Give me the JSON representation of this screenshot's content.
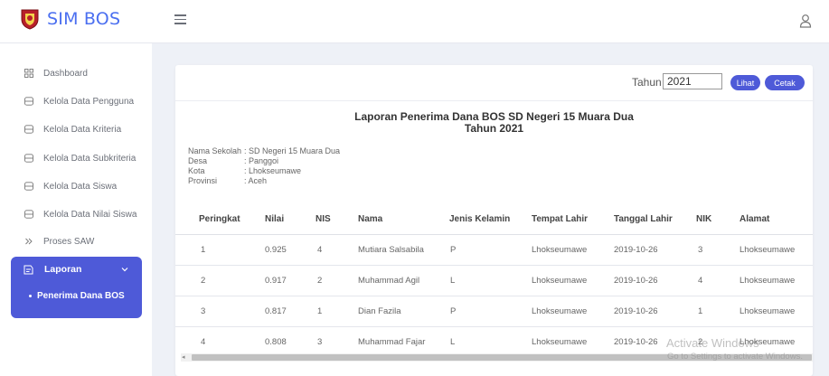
{
  "header": {
    "app_title": "SIM BOS",
    "logo_icon": "shield-emblem-icon",
    "menu_icon": "hamburger-icon",
    "user_icon": "user-icon"
  },
  "sidebar": {
    "items": [
      {
        "label": "Dashboard",
        "icon": "grid-icon"
      },
      {
        "label": "Kelola Data Pengguna",
        "icon": "database-icon"
      },
      {
        "label": "Kelola Data Kriteria",
        "icon": "database-icon"
      },
      {
        "label": "Kelola Data Subkriteria",
        "icon": "database-icon"
      },
      {
        "label": "Kelola Data Siswa",
        "icon": "database-icon"
      },
      {
        "label": "Kelola Data Nilai Siswa",
        "icon": "database-icon"
      },
      {
        "label": "Proses SAW",
        "icon": "double-chevron-icon"
      }
    ],
    "group": {
      "label": "Laporan",
      "icon": "report-icon",
      "sub_item": "Penerima Dana BOS"
    },
    "active_color": "#4e5ad8"
  },
  "filter": {
    "tahun_label": "Tahun",
    "tahun_value": "2021",
    "lihat_label": "Lihat",
    "cetak_label": "Cetak"
  },
  "report": {
    "title": "Laporan Penerima Dana BOS SD Negeri 15 Muara Dua",
    "year_line": "Tahun 2021",
    "info": [
      {
        "key": "Nama Sekolah",
        "value": ": SD Negeri 15 Muara Dua"
      },
      {
        "key": "Desa",
        "value": ": Panggoi"
      },
      {
        "key": "Kota",
        "value": ": Lhokseumawe"
      },
      {
        "key": "Provinsi",
        "value": ": Aceh"
      }
    ]
  },
  "table": {
    "headers": [
      "Peringkat",
      "Nilai",
      "NIS",
      "Nama",
      "Jenis Kelamin",
      "Tempat Lahir",
      "Tanggal Lahir",
      "NIK",
      "Alamat"
    ],
    "rows": [
      [
        "1",
        "0.925",
        "4",
        "Mutiara Salsabila",
        "P",
        "Lhokseumawe",
        "2019-10-26",
        "3",
        "Lhokseumawe"
      ],
      [
        "2",
        "0.917",
        "2",
        "Muhammad Agil",
        "L",
        "Lhokseumawe",
        "2019-10-26",
        "4",
        "Lhokseumawe"
      ],
      [
        "3",
        "0.817",
        "1",
        "Dian Fazila",
        "P",
        "Lhokseumawe",
        "2019-10-26",
        "1",
        "Lhokseumawe"
      ],
      [
        "4",
        "0.808",
        "3",
        "Muhammad Fajar",
        "L",
        "Lhokseumawe",
        "2019-10-26",
        "2",
        "Lhokseumawe"
      ]
    ]
  },
  "watermark": {
    "line1": "Activate Windows",
    "line2": "Go to Settings to activate Windows."
  }
}
